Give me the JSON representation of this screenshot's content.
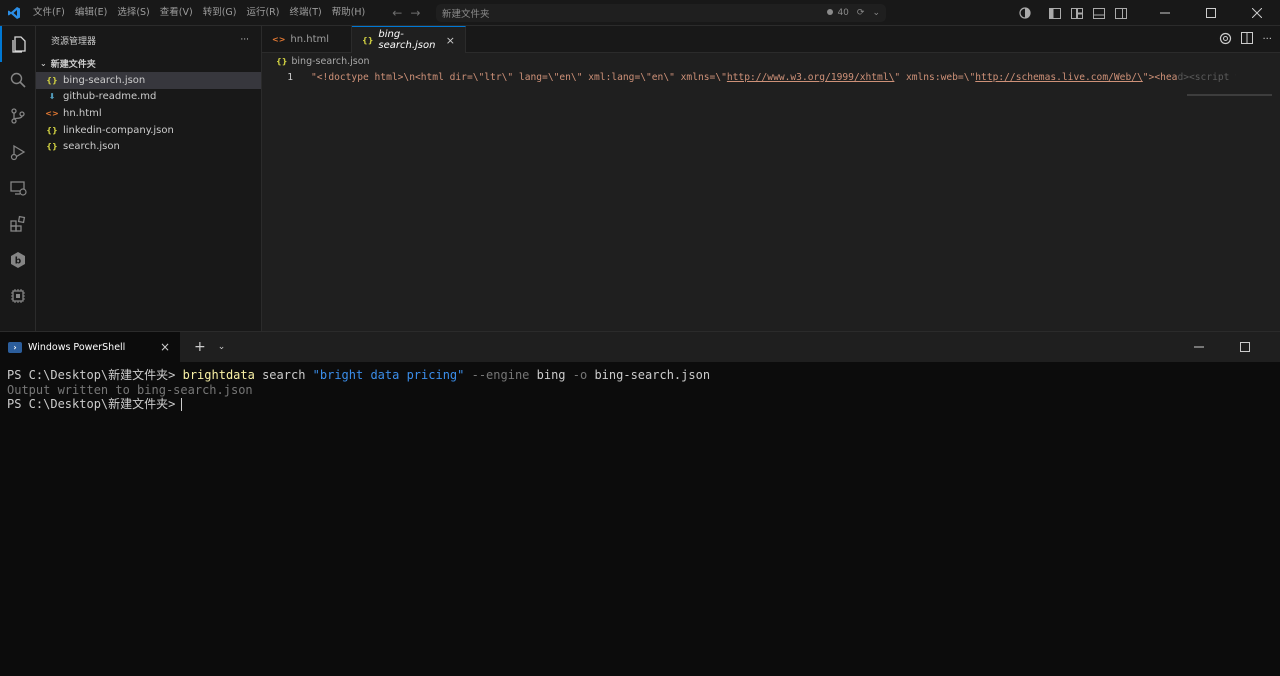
{
  "menu": [
    "文件(F)",
    "编辑(E)",
    "选择(S)",
    "查看(V)",
    "转到(G)",
    "运行(R)",
    "终端(T)",
    "帮助(H)"
  ],
  "command_center": {
    "text": "新建文件夹",
    "port_count": "40"
  },
  "sidebar": {
    "title": "资源管理器",
    "more": "···",
    "folder": "新建文件夹",
    "files": [
      {
        "name": "bing-search.json",
        "icon": "{}",
        "type": "json",
        "active": true
      },
      {
        "name": "github-readme.md",
        "icon": "⬇",
        "type": "md"
      },
      {
        "name": "hn.html",
        "icon": "<>",
        "type": "html"
      },
      {
        "name": "linkedin-company.json",
        "icon": "{}",
        "type": "json"
      },
      {
        "name": "search.json",
        "icon": "{}",
        "type": "json"
      }
    ]
  },
  "editor": {
    "tabs": [
      {
        "label": "hn.html",
        "icon": "<>",
        "active": false
      },
      {
        "label": "bing-search.json",
        "icon": "{}",
        "active": true,
        "close": "×"
      }
    ],
    "breadcrumb": "bing-search.json",
    "line_number": "1",
    "code": {
      "part1": "\"<!doctype html>\\n<html dir=\\\"ltr\\\" lang=\\\"en\\\" xml:lang=\\\"en\\\" xmlns=\\\"",
      "link1": "http://www.w3.org/1999/xhtml\\",
      "part2": "\" xmlns:web=\\\"",
      "link2": "http://schemas.live.com/Web/\\",
      "part3": "\"><hea",
      "fade": "d><script type=\\"
    }
  },
  "terminal": {
    "tab_label": "Windows PowerShell",
    "tab_close": "×",
    "add": "+",
    "dropdown": "⌄",
    "lines": {
      "prompt1": "PS C:\\Desktop\\新建文件夹> ",
      "cmd": "brightdata",
      "arg1": " search ",
      "arg_str": "\"bright data pricing\"",
      "flag1": " --engine",
      "arg2": " bing",
      "flag2": " -o",
      "arg3": " bing-search.json",
      "output": "Output written to bing-search.json",
      "prompt2": "PS C:\\Desktop\\新建文件夹>"
    }
  },
  "colors": {
    "accent": "#0078d4",
    "json_icon": "#cbcb41",
    "html_icon": "#e37933",
    "md_icon": "#519aba"
  }
}
